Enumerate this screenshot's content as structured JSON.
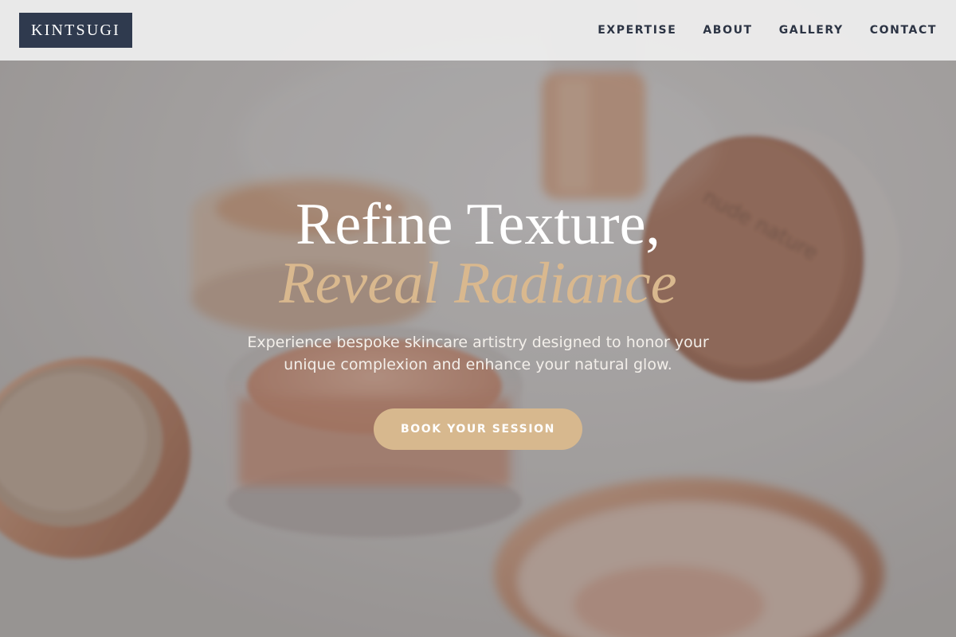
{
  "header": {
    "logo_text": "KINTSUGI",
    "nav": [
      {
        "label": "EXPERTISE"
      },
      {
        "label": "ABOUT"
      },
      {
        "label": "GALLERY"
      },
      {
        "label": "CONTACT"
      }
    ]
  },
  "hero": {
    "headline_line1": "Refine Texture,",
    "headline_line2": "Reveal Radiance",
    "subtext": "Experience bespoke skincare artistry designed to honor your unique complexion and enhance your natural glow.",
    "cta_label": "BOOK YOUR SESSION",
    "background_image": "cosmetic-powder-jars-photo"
  },
  "colors": {
    "logo_bg": "#2f3a4e",
    "nav_text": "#2c3444",
    "accent_gold": "#d7b88e",
    "header_bg": "#ececec"
  }
}
